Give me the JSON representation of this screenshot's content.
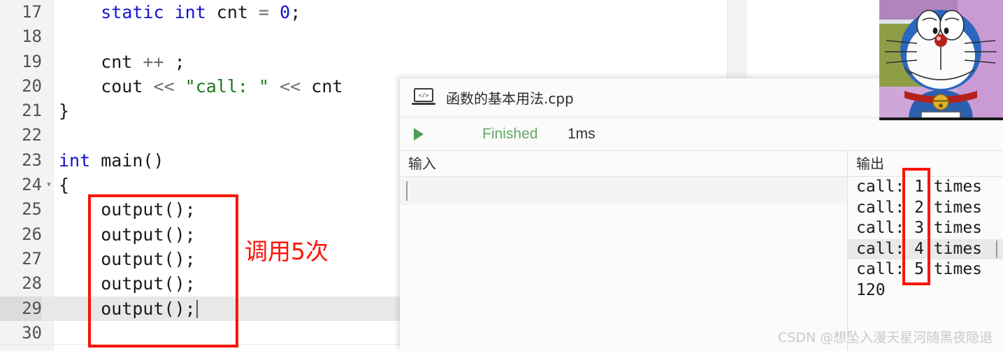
{
  "editor": {
    "lines": [
      {
        "num": "17",
        "fold": "",
        "current": false,
        "segments": [
          {
            "t": "    ",
            "c": "plain"
          },
          {
            "t": "static",
            "c": "kw"
          },
          {
            "t": " ",
            "c": "plain"
          },
          {
            "t": "int",
            "c": "kw"
          },
          {
            "t": " cnt ",
            "c": "plain"
          },
          {
            "t": "=",
            "c": "op"
          },
          {
            "t": " ",
            "c": "plain"
          },
          {
            "t": "0",
            "c": "kw"
          },
          {
            "t": ";",
            "c": "plain"
          }
        ]
      },
      {
        "num": "18",
        "fold": "",
        "current": false,
        "segments": []
      },
      {
        "num": "19",
        "fold": "",
        "current": false,
        "segments": [
          {
            "t": "    cnt ",
            "c": "plain"
          },
          {
            "t": "++",
            "c": "op"
          },
          {
            "t": " ;",
            "c": "plain"
          }
        ]
      },
      {
        "num": "20",
        "fold": "",
        "current": false,
        "segments": [
          {
            "t": "    cout ",
            "c": "plain"
          },
          {
            "t": "<<",
            "c": "op"
          },
          {
            "t": " ",
            "c": "plain"
          },
          {
            "t": "\"call: \"",
            "c": "str"
          },
          {
            "t": " ",
            "c": "plain"
          },
          {
            "t": "<<",
            "c": "op"
          },
          {
            "t": " cnt ",
            "c": "plain"
          }
        ]
      },
      {
        "num": "21",
        "fold": "",
        "current": false,
        "segments": [
          {
            "t": "}",
            "c": "plain"
          }
        ]
      },
      {
        "num": "22",
        "fold": "",
        "current": false,
        "segments": []
      },
      {
        "num": "23",
        "fold": "",
        "current": false,
        "segments": [
          {
            "t": "int",
            "c": "kw"
          },
          {
            "t": " main()",
            "c": "plain"
          }
        ]
      },
      {
        "num": "24",
        "fold": "▾",
        "current": false,
        "segments": [
          {
            "t": "{",
            "c": "plain"
          }
        ]
      },
      {
        "num": "25",
        "fold": "",
        "current": false,
        "segments": [
          {
            "t": "    output();",
            "c": "plain"
          }
        ]
      },
      {
        "num": "26",
        "fold": "",
        "current": false,
        "segments": [
          {
            "t": "    output();",
            "c": "plain"
          }
        ]
      },
      {
        "num": "27",
        "fold": "",
        "current": false,
        "segments": [
          {
            "t": "    output();",
            "c": "plain"
          }
        ]
      },
      {
        "num": "28",
        "fold": "",
        "current": false,
        "segments": [
          {
            "t": "    output();",
            "c": "plain"
          }
        ]
      },
      {
        "num": "29",
        "fold": "",
        "current": true,
        "caret": true,
        "segments": [
          {
            "t": "    output();",
            "c": "plain"
          }
        ]
      },
      {
        "num": "30",
        "fold": "",
        "current": false,
        "segments": []
      }
    ]
  },
  "annotations": {
    "code_note": "调用5次",
    "red_color": "#fa1405"
  },
  "run_panel": {
    "filename": "函数的基本用法.cpp",
    "status_label": "Finished",
    "status_color": "#62a866",
    "elapsed": "1ms",
    "input_header": "输入",
    "output_header": "输出",
    "input_lines": [
      ""
    ],
    "output_lines": [
      {
        "text": "call: 1 times",
        "highlight": false
      },
      {
        "text": "call: 2 times",
        "highlight": false
      },
      {
        "text": "call: 3 times",
        "highlight": false
      },
      {
        "text": "call: 4 times",
        "highlight": true
      },
      {
        "text": "call: 5 times",
        "highlight": false
      },
      {
        "text": "120",
        "highlight": false
      }
    ]
  },
  "watermark": {
    "text": "CSDN @想坠入漫天星河随黑夜隐退"
  },
  "overlay_image": {
    "name": "doraemon-cartoon"
  }
}
